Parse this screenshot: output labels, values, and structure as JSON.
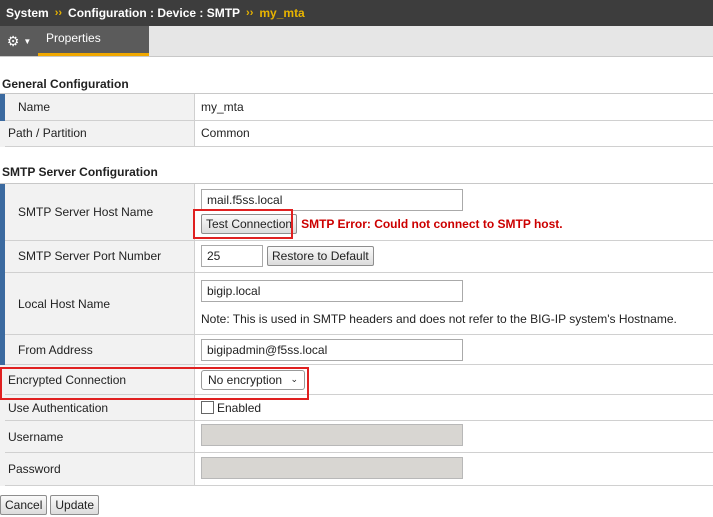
{
  "breadcrumb": {
    "root": "System",
    "section": "Configuration : Device : SMTP",
    "current": "my_mta",
    "separator": "››"
  },
  "tabs": {
    "gear_icon": "gear-icon",
    "active_tab": "Properties"
  },
  "general": {
    "title": "General Configuration",
    "name_label": "Name",
    "name_value": "my_mta",
    "partition_label": "Path / Partition",
    "partition_value": "Common"
  },
  "smtp": {
    "title": "SMTP Server Configuration",
    "host_label": "SMTP Server Host Name",
    "host_value": "mail.f5ss.local",
    "test_button": "Test Connection",
    "error_text": "SMTP Error: Could not connect to SMTP host.",
    "port_label": "SMTP Server Port Number",
    "port_value": "25",
    "restore_button": "Restore to Default",
    "local_host_label": "Local Host Name",
    "local_host_value": "bigip.local",
    "local_host_note": "Note: This is used in SMTP headers and does not refer to the BIG-IP system's Hostname.",
    "from_label": "From Address",
    "from_value": "bigipadmin@f5ss.local",
    "encryption_label": "Encrypted Connection",
    "encryption_value": "No encryption",
    "auth_label": "Use Authentication",
    "auth_checkbox_label": "Enabled",
    "auth_enabled": false,
    "username_label": "Username",
    "password_label": "Password"
  },
  "actions": {
    "cancel": "Cancel",
    "update": "Update"
  },
  "colors": {
    "header_bg": "#3d3d3d",
    "accent": "#e8b400",
    "error": "#cc0000",
    "highlight": "#e02020",
    "label_bar": "#3b6aa0"
  }
}
